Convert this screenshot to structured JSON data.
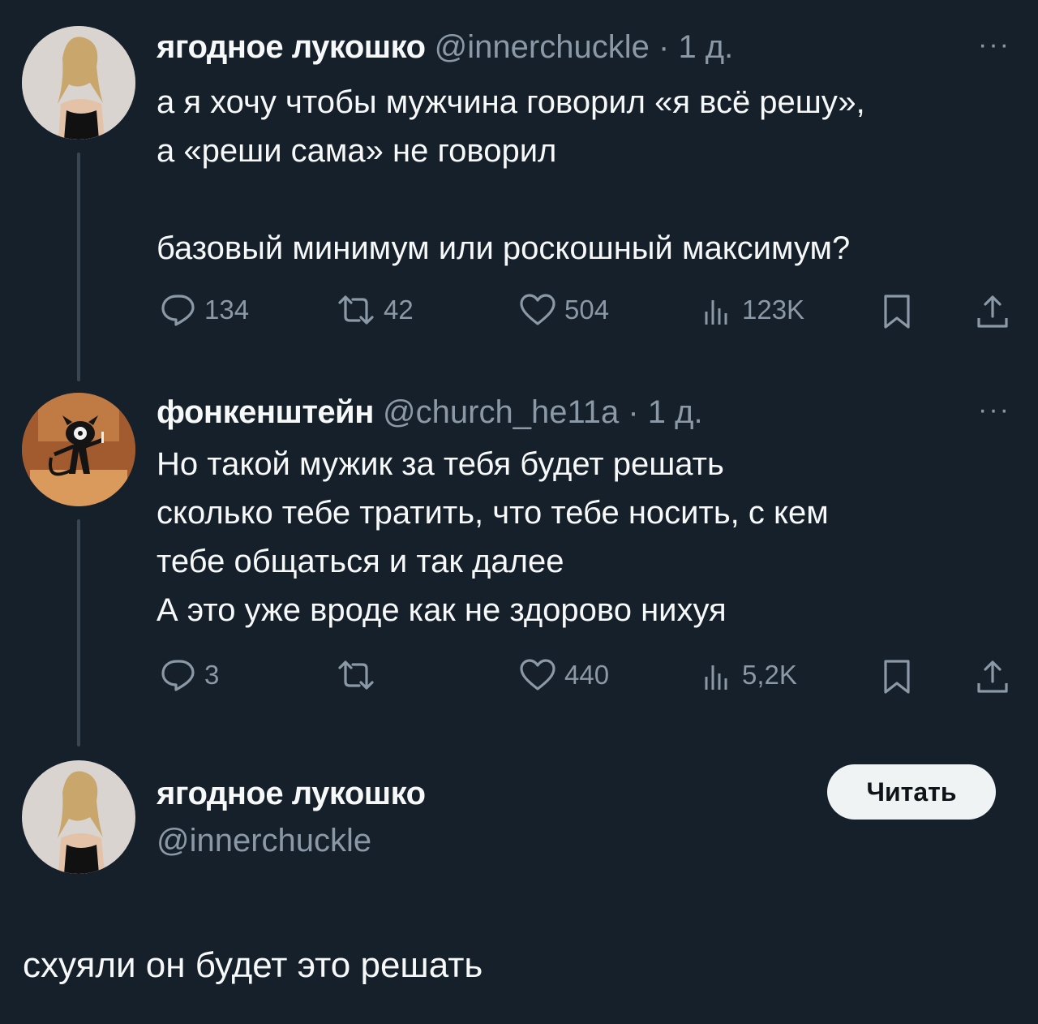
{
  "tweets": [
    {
      "name": "ягодное лукошко",
      "handle": "@innerchuckle",
      "dot": "·",
      "time": "1 д.",
      "more": "···",
      "text": "а я хочу чтобы мужчина говорил «я всё решу»,\nа «реши сама» не говорил\n\nбазовый минимум или роскошный максимум?",
      "replies": "134",
      "retweets": "42",
      "likes": "504",
      "views": "123K"
    },
    {
      "name": "фонкенштейн",
      "handle": "@church_he11a",
      "dot": "·",
      "time": "1 д.",
      "more": "···",
      "text": "Но такой мужик за тебя будет решать\nсколько тебе тратить, что тебе носить, с кем\nтебе общаться и так далее\nА это уже вроде как не здорово нихуя",
      "replies": "3",
      "retweets": "",
      "likes": "440",
      "views": "5,2K"
    }
  ],
  "main_tweet": {
    "name": "ягодное лукошко",
    "handle": "@innerchuckle",
    "follow_label": "Читать",
    "text": "схуяли он будет это решать"
  },
  "icons": {
    "reply": "reply-icon",
    "retweet": "retweet-icon",
    "like": "heart-icon",
    "views": "views-icon",
    "bookmark": "bookmark-icon",
    "share": "share-icon"
  },
  "colors": {
    "background": "#15202b",
    "text": "#f7f9f9",
    "muted": "#8b98a5",
    "button": "#eff3f4"
  }
}
